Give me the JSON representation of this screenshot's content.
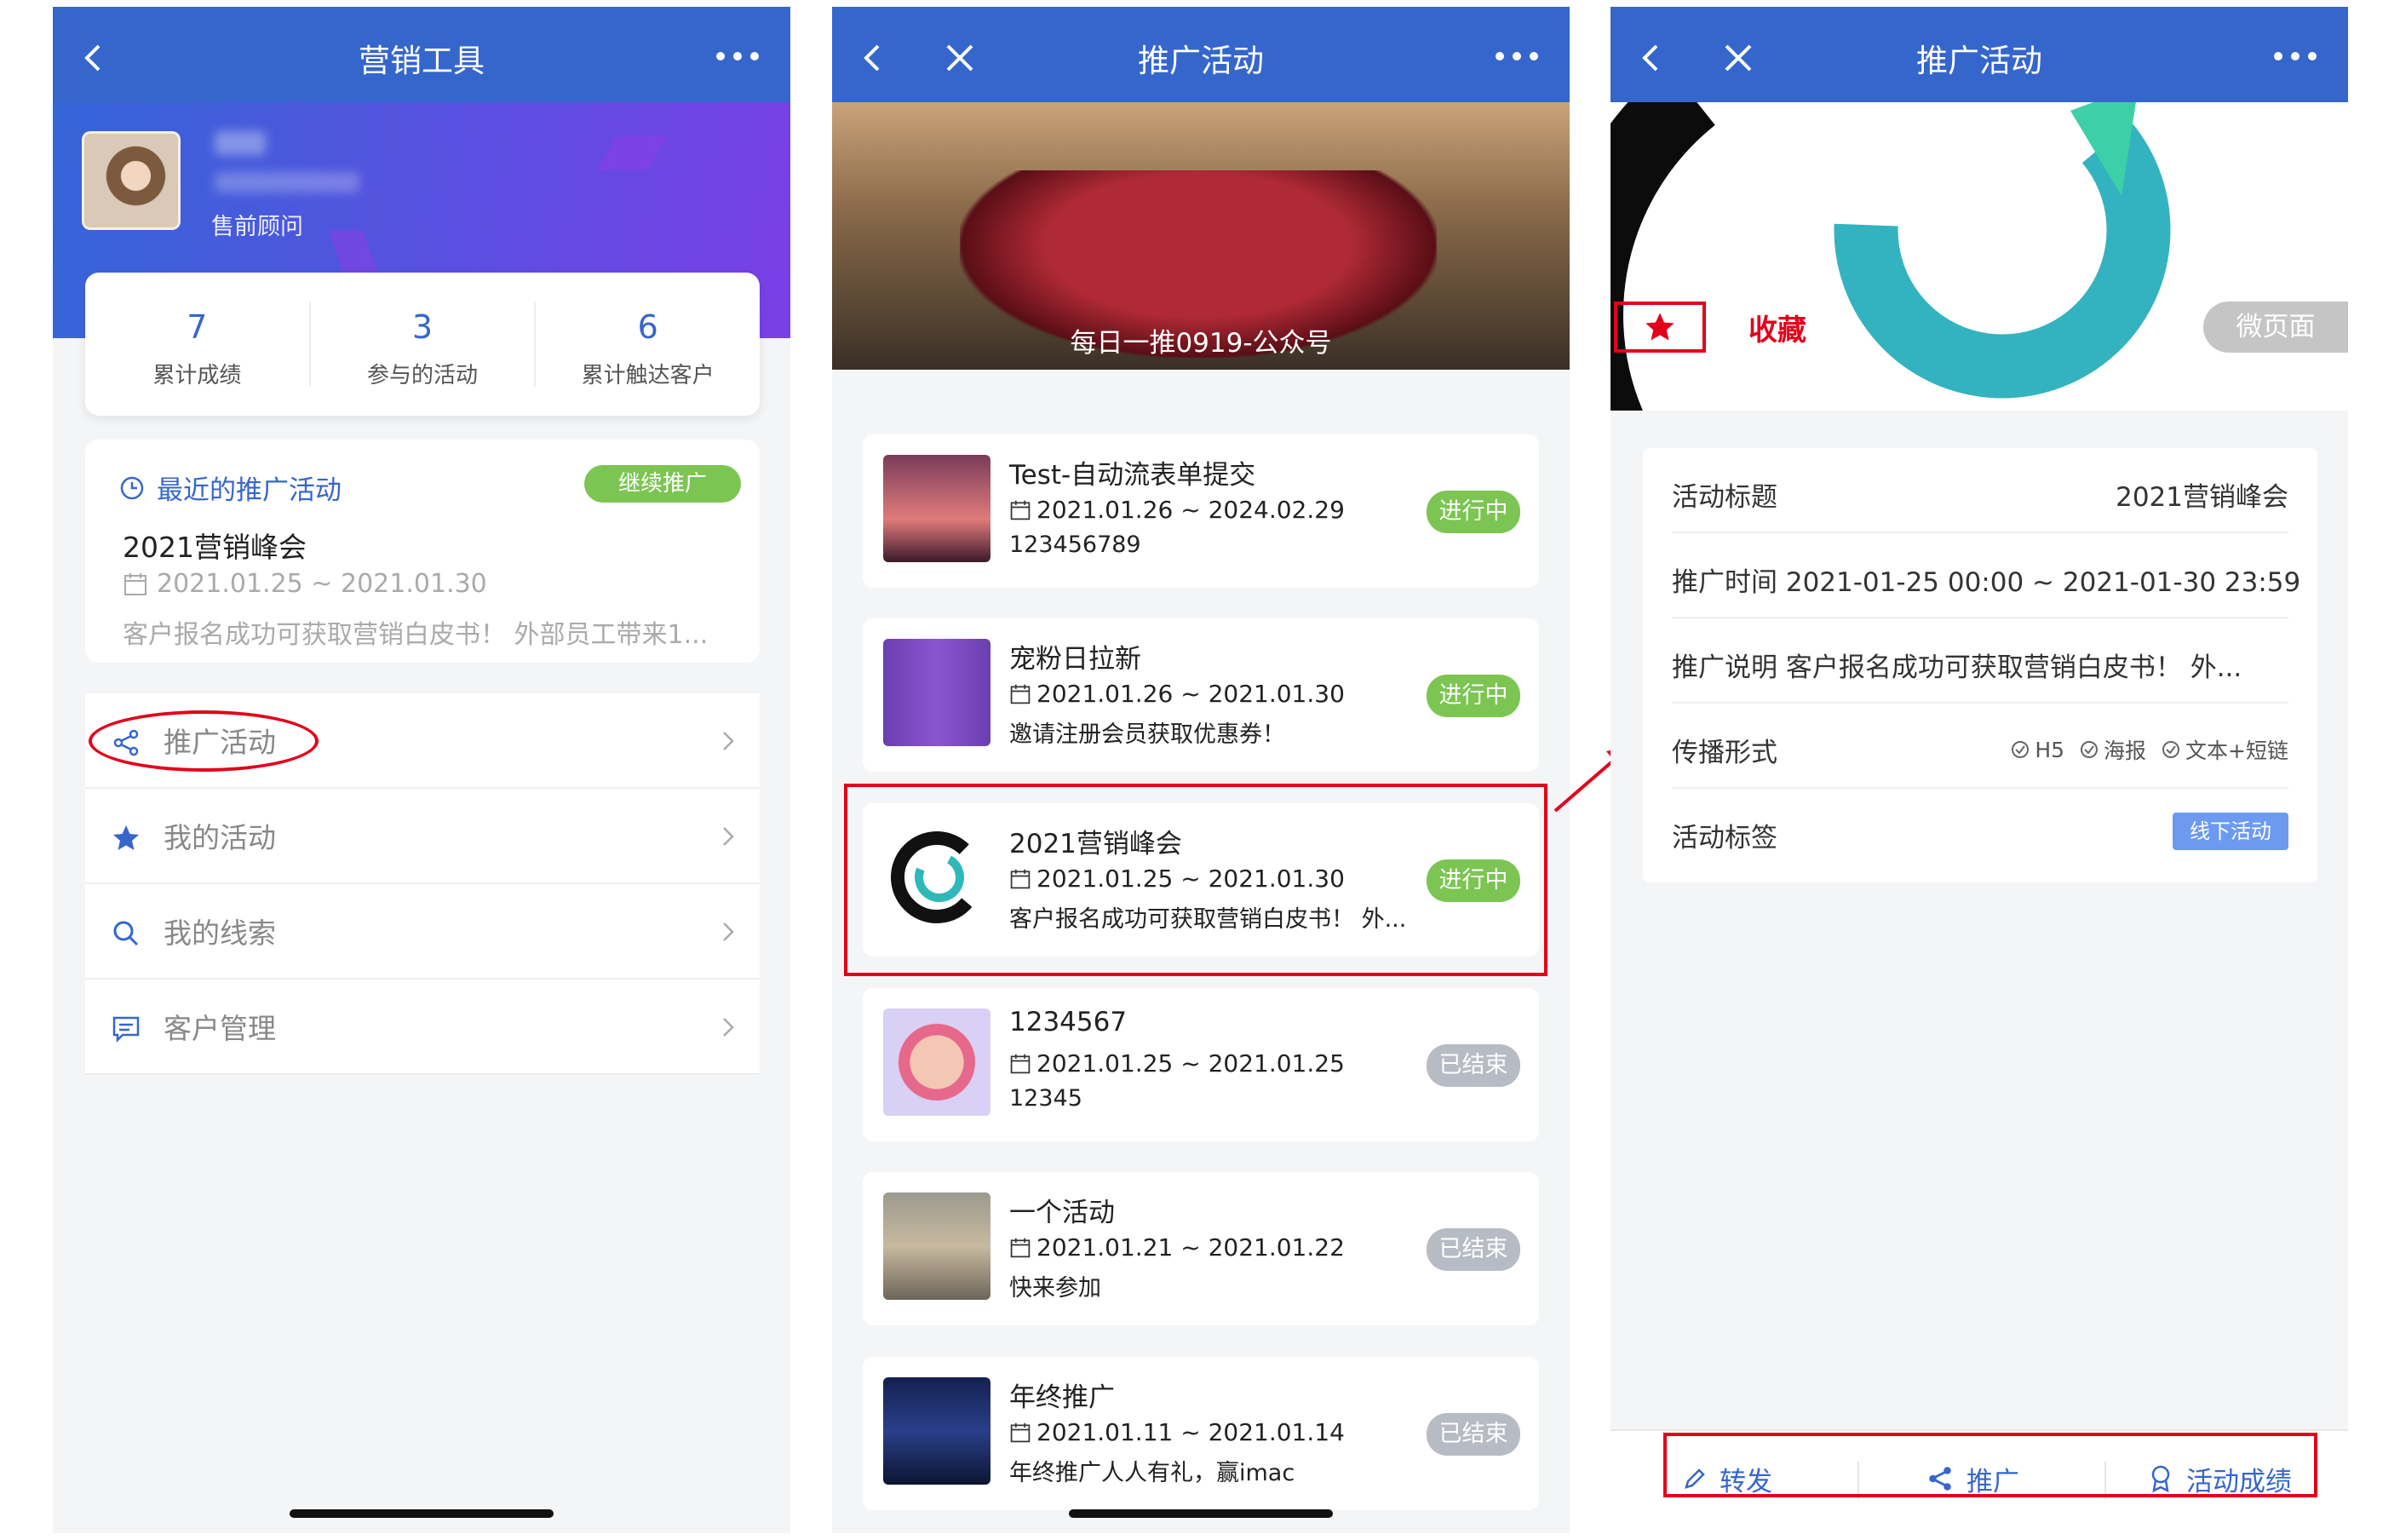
{
  "phone1": {
    "nav_title": "营销工具",
    "profile": {
      "role": "售前顾问"
    },
    "stats": [
      {
        "value": "7",
        "label": "累计成绩"
      },
      {
        "value": "3",
        "label": "参与的活动"
      },
      {
        "value": "6",
        "label": "累计触达客户"
      }
    ],
    "recent": {
      "heading": "最近的推广活动",
      "badge": "继续推广",
      "name": "2021营销峰会",
      "date": "2021.01.25 ~ 2021.01.30",
      "desc": "客户报名成功可获取营销白皮书！ 外部员工带来1..."
    },
    "menu": [
      {
        "label": "推广活动",
        "icon": "share-icon"
      },
      {
        "label": "我的活动",
        "icon": "star-icon"
      },
      {
        "label": "我的线索",
        "icon": "search-icon"
      },
      {
        "label": "客户管理",
        "icon": "chat-icon"
      }
    ]
  },
  "phone2": {
    "nav_title": "推广活动",
    "banner_caption": "每日一推0919-公众号",
    "activities": [
      {
        "name": "Test-自动流表单提交",
        "date": "2021.01.26 ~ 2024.02.29",
        "desc": "123456789",
        "status": "进行中"
      },
      {
        "name": "宠粉日拉新",
        "date": "2021.01.26 ~ 2021.01.30",
        "desc": "邀请注册会员获取优惠券！",
        "status": "进行中"
      },
      {
        "name": "2021营销峰会",
        "date": "2021.01.25 ~ 2021.01.30",
        "desc": "客户报名成功可获取营销白皮书！ 外...",
        "status": "进行中"
      },
      {
        "name": "1234567",
        "date": "2021.01.25 ~ 2021.01.25",
        "desc": "12345",
        "status": "已结束"
      },
      {
        "name": "一个活动",
        "date": "2021.01.21 ~ 2021.01.22",
        "desc": "快来参加",
        "status": "已结束"
      },
      {
        "name": "年终推广",
        "date": "2021.01.11 ~ 2021.01.14",
        "desc": "年终推广人人有礼，赢imac",
        "status": "已结束"
      }
    ]
  },
  "phone3": {
    "nav_title": "推广活动",
    "favorite_label": "收藏",
    "micro_page": "微页面",
    "details": {
      "title_key": "活动标题",
      "title_val": "2021营销峰会",
      "time_line": "推广时间  2021-01-25 00:00 ~ 2021-01-30 23:59",
      "desc_line": "推广说明 客户报名成功可获取营销白皮书！ 外...",
      "format_key": "传播形式",
      "formats": [
        "H5",
        "海报",
        "文本+短链"
      ],
      "tag_key": "活动标签",
      "tag_val": "线下活动"
    },
    "bottom": {
      "forward": "转发",
      "promote": "推广",
      "results": "活动成绩"
    }
  },
  "colors": {
    "brand": "#3566cc",
    "active": "#7cc552",
    "ended": "#b7bcc4",
    "highlight": "#e3001b"
  }
}
